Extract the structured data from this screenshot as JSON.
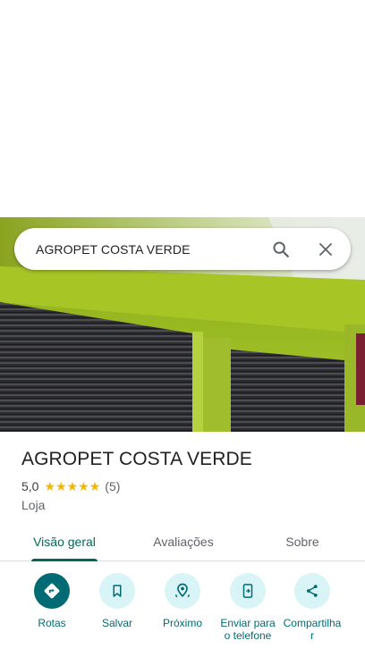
{
  "search": {
    "query": "AGROPET COSTA VERDE",
    "search_icon": "search-icon",
    "close_icon": "close-icon"
  },
  "place": {
    "name": "AGROPET COSTA VERDE",
    "rating": "5,0",
    "stars": 5,
    "review_count": "(5)",
    "category": "Loja"
  },
  "tabs": [
    {
      "label": "Visão geral",
      "active": true
    },
    {
      "label": "Avaliações",
      "active": false
    },
    {
      "label": "Sobre",
      "active": false
    }
  ],
  "actions": [
    {
      "label": "Rotas",
      "icon": "directions-icon"
    },
    {
      "label": "Salvar",
      "icon": "bookmark-icon"
    },
    {
      "label": "Próximo",
      "icon": "nearby-icon"
    },
    {
      "label": "Enviar para o telefone",
      "icon": "send-to-phone-icon"
    },
    {
      "label": "Compartilhar",
      "icon": "share-icon"
    }
  ],
  "colors": {
    "accent": "#006b73",
    "tab_active": "#00695c",
    "action_bg": "#d8f4f6",
    "star": "#f4b400",
    "wall": "#9bbf1f"
  }
}
